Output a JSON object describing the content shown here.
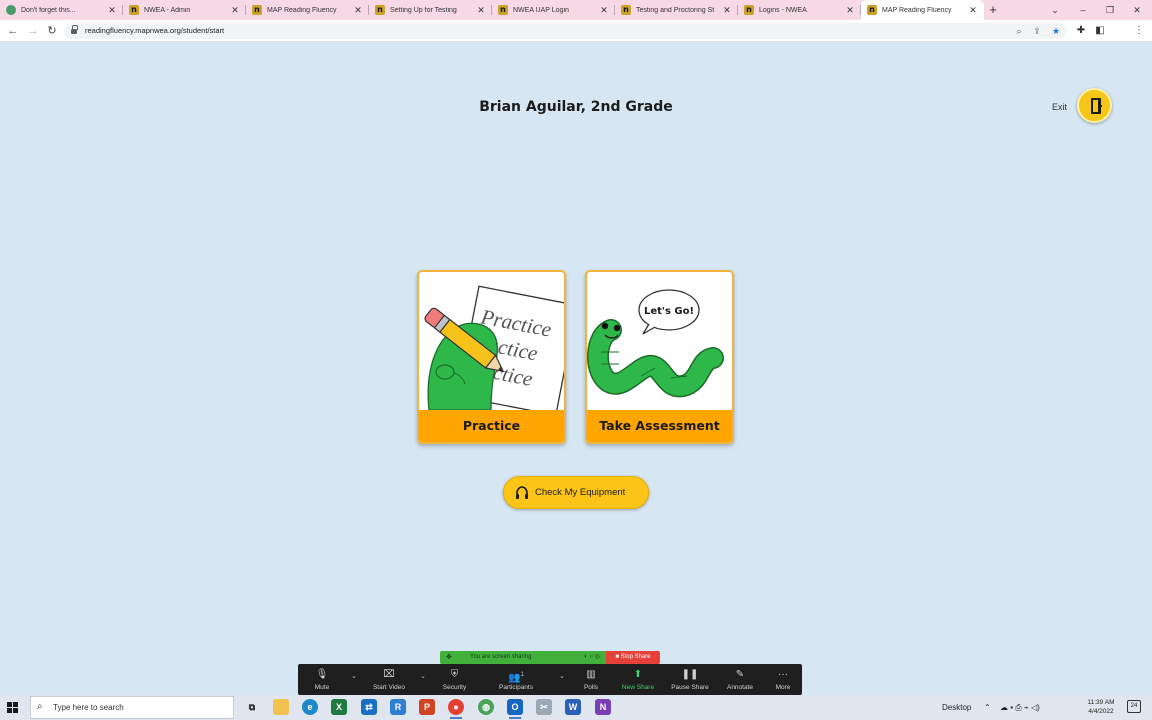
{
  "browser": {
    "tabs": [
      {
        "title": "Don't forget this...",
        "favicon": "globe-icon",
        "active": false
      },
      {
        "title": "NWEA - Admin",
        "favicon": "nwea-icon",
        "active": false
      },
      {
        "title": "MAP Reading Fluency",
        "favicon": "nwea-icon",
        "active": false
      },
      {
        "title": "Setting Up for Testing",
        "favicon": "nwea-icon",
        "active": false
      },
      {
        "title": "NWEA UAP Login",
        "favicon": "nwea-icon",
        "active": false
      },
      {
        "title": "Testing and Proctoring St",
        "favicon": "nwea-icon",
        "active": false
      },
      {
        "title": "Logins - NWEA",
        "favicon": "nwea-icon",
        "active": false
      },
      {
        "title": "MAP Reading Fluency",
        "favicon": "nwea-icon",
        "active": true
      }
    ],
    "url": "readingfluency.mapnwea.org/student/start"
  },
  "page": {
    "student_name": "Brian Aguilar, 2nd Grade",
    "exit_label": "Exit",
    "practice_card": {
      "label": "Practice",
      "art_lines": [
        "Practice",
        "actice",
        "actice"
      ]
    },
    "assessment_card": {
      "label": "Take Assessment",
      "speech": "Let's Go!"
    },
    "equipment_button": "Check My Equipment",
    "colors": {
      "background": "#d6e7f3",
      "card_label": "#ffa500",
      "button": "#fbc417",
      "worm": "#2fb84a"
    }
  },
  "zoom": {
    "share_status": "You are screen sharing",
    "stop_share": "Stop Share",
    "participants_count": "1",
    "toolbar": [
      {
        "label": "Mute",
        "icon": "microphone-icon"
      },
      {
        "label": "Start Video",
        "icon": "video-off-icon"
      },
      {
        "label": "Security",
        "icon": "shield-icon"
      },
      {
        "label": "Participants",
        "icon": "participants-icon"
      },
      {
        "label": "Polls",
        "icon": "polls-icon"
      },
      {
        "label": "New Share",
        "icon": "share-screen-icon"
      },
      {
        "label": "Pause Share",
        "icon": "pause-icon"
      },
      {
        "label": "Annotate",
        "icon": "pencil-icon"
      },
      {
        "label": "More",
        "icon": "more-icon"
      }
    ]
  },
  "taskbar": {
    "search_placeholder": "Type here to search",
    "desktop_label": "Desktop",
    "time": "11:39 AM",
    "date": "4/4/2022",
    "notification_count": "24"
  }
}
